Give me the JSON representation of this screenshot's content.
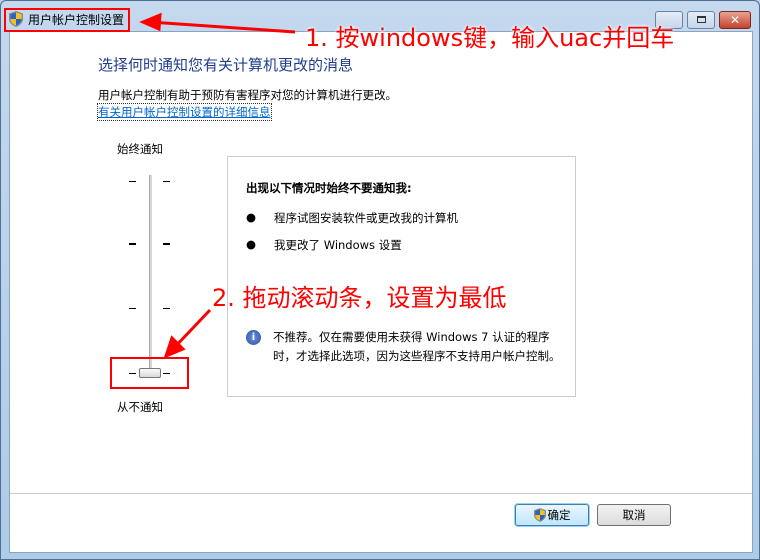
{
  "window": {
    "title": "用户帐户控制设置",
    "controls": [
      "minimize",
      "maximize",
      "close"
    ]
  },
  "heading": "选择何时通知您有关计算机更改的消息",
  "description": "用户帐户控制有助于预防有害程序对您的计算机进行更改。",
  "more_info_link": "有关用户帐户控制设置的详细信息",
  "slider": {
    "top_label": "始终通知",
    "bottom_label": "从不通知",
    "level": 0,
    "levels": 4
  },
  "panel": {
    "title": "出现以下情况时始终不要通知我:",
    "bullets": [
      "程序试图安装软件或更改我的计算机",
      "我更改了 Windows 设置"
    ],
    "note": "不推荐。仅在需要使用未获得 Windows 7 认证的程序时，才选择此选项，因为这些程序不支持用户帐户控制。"
  },
  "buttons": {
    "ok": "确定",
    "cancel": "取消"
  },
  "annotations": {
    "step1": "1. 按windows键，输入uac并回车",
    "step2": "2. 拖动滚动条，设置为最低"
  },
  "colors": {
    "annotation": "#ff0000",
    "heading": "#1e3e8c",
    "link": "#0066cc"
  }
}
